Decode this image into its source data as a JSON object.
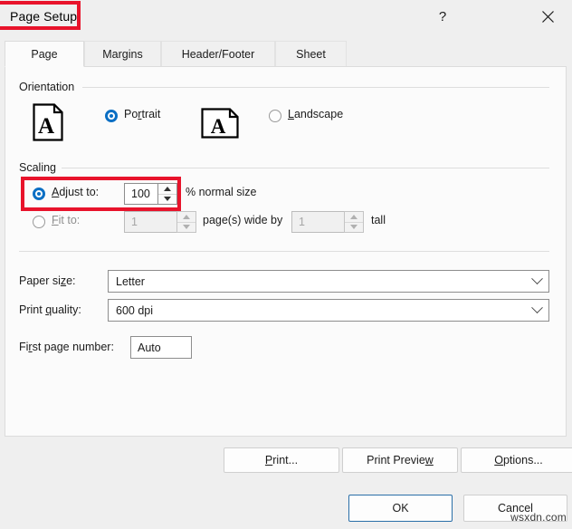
{
  "window": {
    "title": "Page Setup",
    "help_icon": "question-mark-icon",
    "close_icon": "close-icon"
  },
  "tabs": [
    {
      "label": "Page",
      "active": true
    },
    {
      "label": "Margins",
      "active": false
    },
    {
      "label": "Header/Footer",
      "active": false
    },
    {
      "label": "Sheet",
      "active": false
    }
  ],
  "orientation": {
    "group_label": "Orientation",
    "portrait": {
      "label_pre": "Po",
      "label_key": "r",
      "label_post": "trait",
      "selected": true
    },
    "landscape": {
      "label_key": "L",
      "label_post": "andscape",
      "selected": false
    }
  },
  "scaling": {
    "group_label": "Scaling",
    "adjust_to": {
      "label_key": "A",
      "label_post": "djust to:",
      "selected": true,
      "value": "100",
      "suffix": "% normal size"
    },
    "fit_to": {
      "label_key": "F",
      "label_post": "it to:",
      "selected": false,
      "wide_value": "1",
      "wide_suffix": "page(s) wide by",
      "tall_value": "1",
      "tall_suffix": "tall"
    }
  },
  "paper": {
    "size_label_pre": "Paper si",
    "size_label_key": "z",
    "size_label_post": "e:",
    "size_value": "Letter",
    "quality_label_pre": "Print ",
    "quality_label_key": "q",
    "quality_label_post": "uality:",
    "quality_value": "600 dpi"
  },
  "first_page": {
    "label_pre": "Fi",
    "label_key": "r",
    "label_post": "st page number:",
    "value": "Auto"
  },
  "action_buttons": [
    {
      "name": "print-button",
      "key": "P",
      "post": "rint..."
    },
    {
      "name": "print-preview-button",
      "pre": "Print Previe",
      "key": "w",
      "post": ""
    },
    {
      "name": "options-button",
      "key": "O",
      "post": "ptions..."
    }
  ],
  "footer_buttons": {
    "ok": "OK",
    "cancel": "Cancel"
  },
  "watermark": "wsxdn.com",
  "colors": {
    "accent": "#0b6fc4",
    "highlight": "#e8132b",
    "panel": "#fbfbfb",
    "dialog": "#efefef"
  }
}
